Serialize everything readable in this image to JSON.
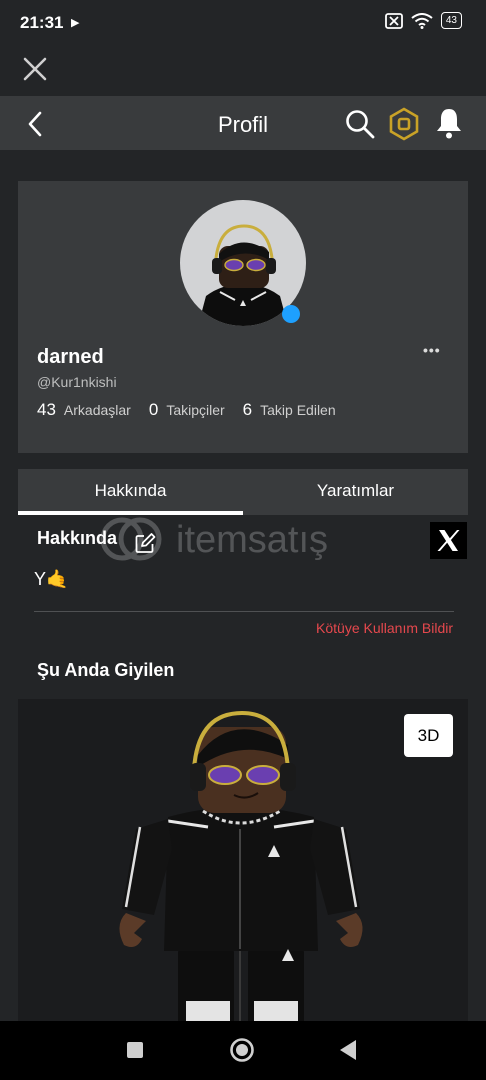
{
  "status_bar": {
    "time": "21:31",
    "battery": "43"
  },
  "header": {
    "title": "Profil"
  },
  "profile": {
    "display_name": "darned",
    "username": "@Kur1nkishi",
    "more": "•••",
    "stats": [
      {
        "count": "43",
        "label": "Arkadaşlar"
      },
      {
        "count": "0",
        "label": "Takipçiler"
      },
      {
        "count": "6",
        "label": "Takip Edilen"
      }
    ]
  },
  "tabs": [
    {
      "label": "Hakkında"
    },
    {
      "label": "Yaratımlar"
    }
  ],
  "about": {
    "title": "Hakkında",
    "text": "Y🤙",
    "report_label": "Kötüye Kullanım Bildir",
    "watermark": "itemsatış"
  },
  "wearing": {
    "title": "Şu Anda Giyilen",
    "view_3d_label": "3D"
  },
  "colors": {
    "online": "#1ea0ff",
    "report": "#e5484d",
    "robux_gold": "#c9a227"
  }
}
